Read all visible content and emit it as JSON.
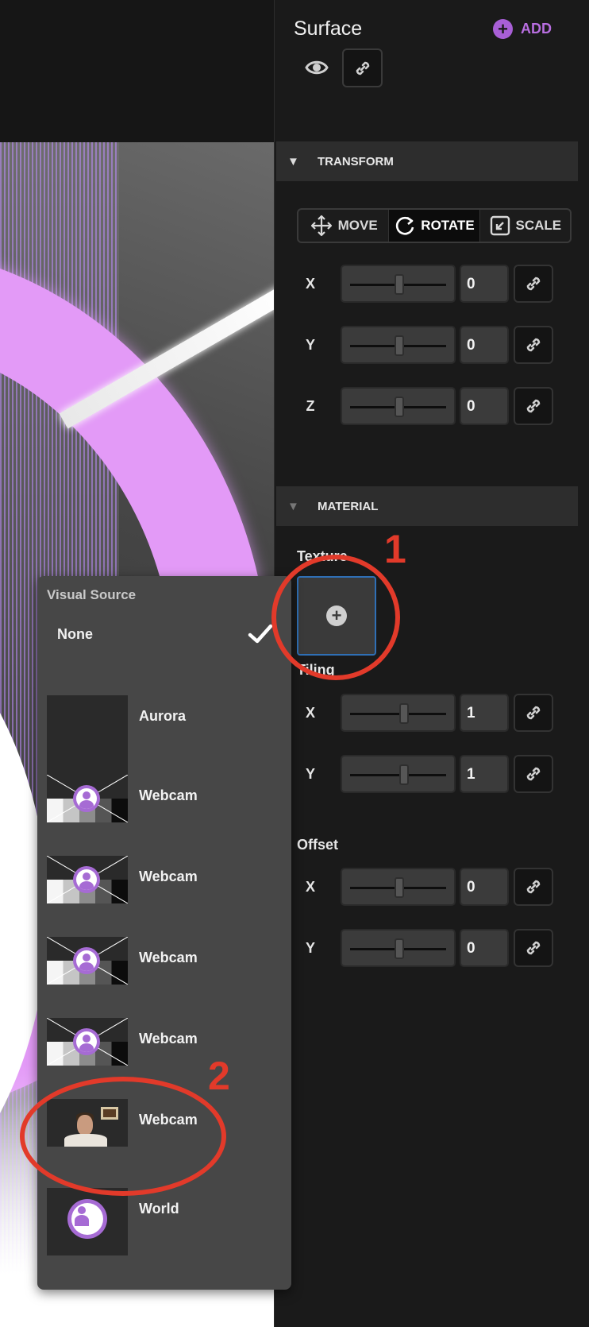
{
  "panel": {
    "title": "Surface",
    "add_label": "ADD"
  },
  "transform": {
    "header": "TRANSFORM",
    "modes": [
      {
        "label": "MOVE",
        "icon": "move-icon",
        "active": false
      },
      {
        "label": "ROTATE",
        "icon": "rotate-icon",
        "active": true
      },
      {
        "label": "SCALE",
        "icon": "scale-icon",
        "active": false
      }
    ],
    "rows": [
      {
        "axis": "X",
        "value": "0"
      },
      {
        "axis": "Y",
        "value": "0"
      },
      {
        "axis": "Z",
        "value": "0"
      }
    ]
  },
  "material": {
    "header": "MATERIAL",
    "texture_label": "Texture",
    "tiling_label": "Tiling",
    "tiling_rows": [
      {
        "axis": "X",
        "value": "1"
      },
      {
        "axis": "Y",
        "value": "1"
      }
    ],
    "offset_label": "Offset",
    "offset_rows": [
      {
        "axis": "X",
        "value": "0"
      },
      {
        "axis": "Y",
        "value": "0"
      }
    ]
  },
  "visual_source_menu": {
    "title": "Visual Source",
    "none_label": "None",
    "options": [
      {
        "label": "Aurora",
        "thumb": "aurora"
      },
      {
        "label": "Webcam",
        "thumb": "webcam-placeholder"
      },
      {
        "label": "Webcam",
        "thumb": "webcam-placeholder"
      },
      {
        "label": "Webcam",
        "thumb": "webcam-placeholder"
      },
      {
        "label": "Webcam",
        "thumb": "webcam-placeholder"
      },
      {
        "label": "Webcam",
        "thumb": "webcam-photo"
      },
      {
        "label": "World",
        "thumb": "world"
      }
    ]
  },
  "annotations": {
    "one": "1",
    "two": "2",
    "color": "#e23a2a"
  },
  "colors": {
    "accent": "#b86ee0",
    "panel_bg": "#1a1a1a",
    "section_bg": "#2d2d2d",
    "menu_bg": "#474747",
    "selection_border": "#2f6fb5"
  }
}
